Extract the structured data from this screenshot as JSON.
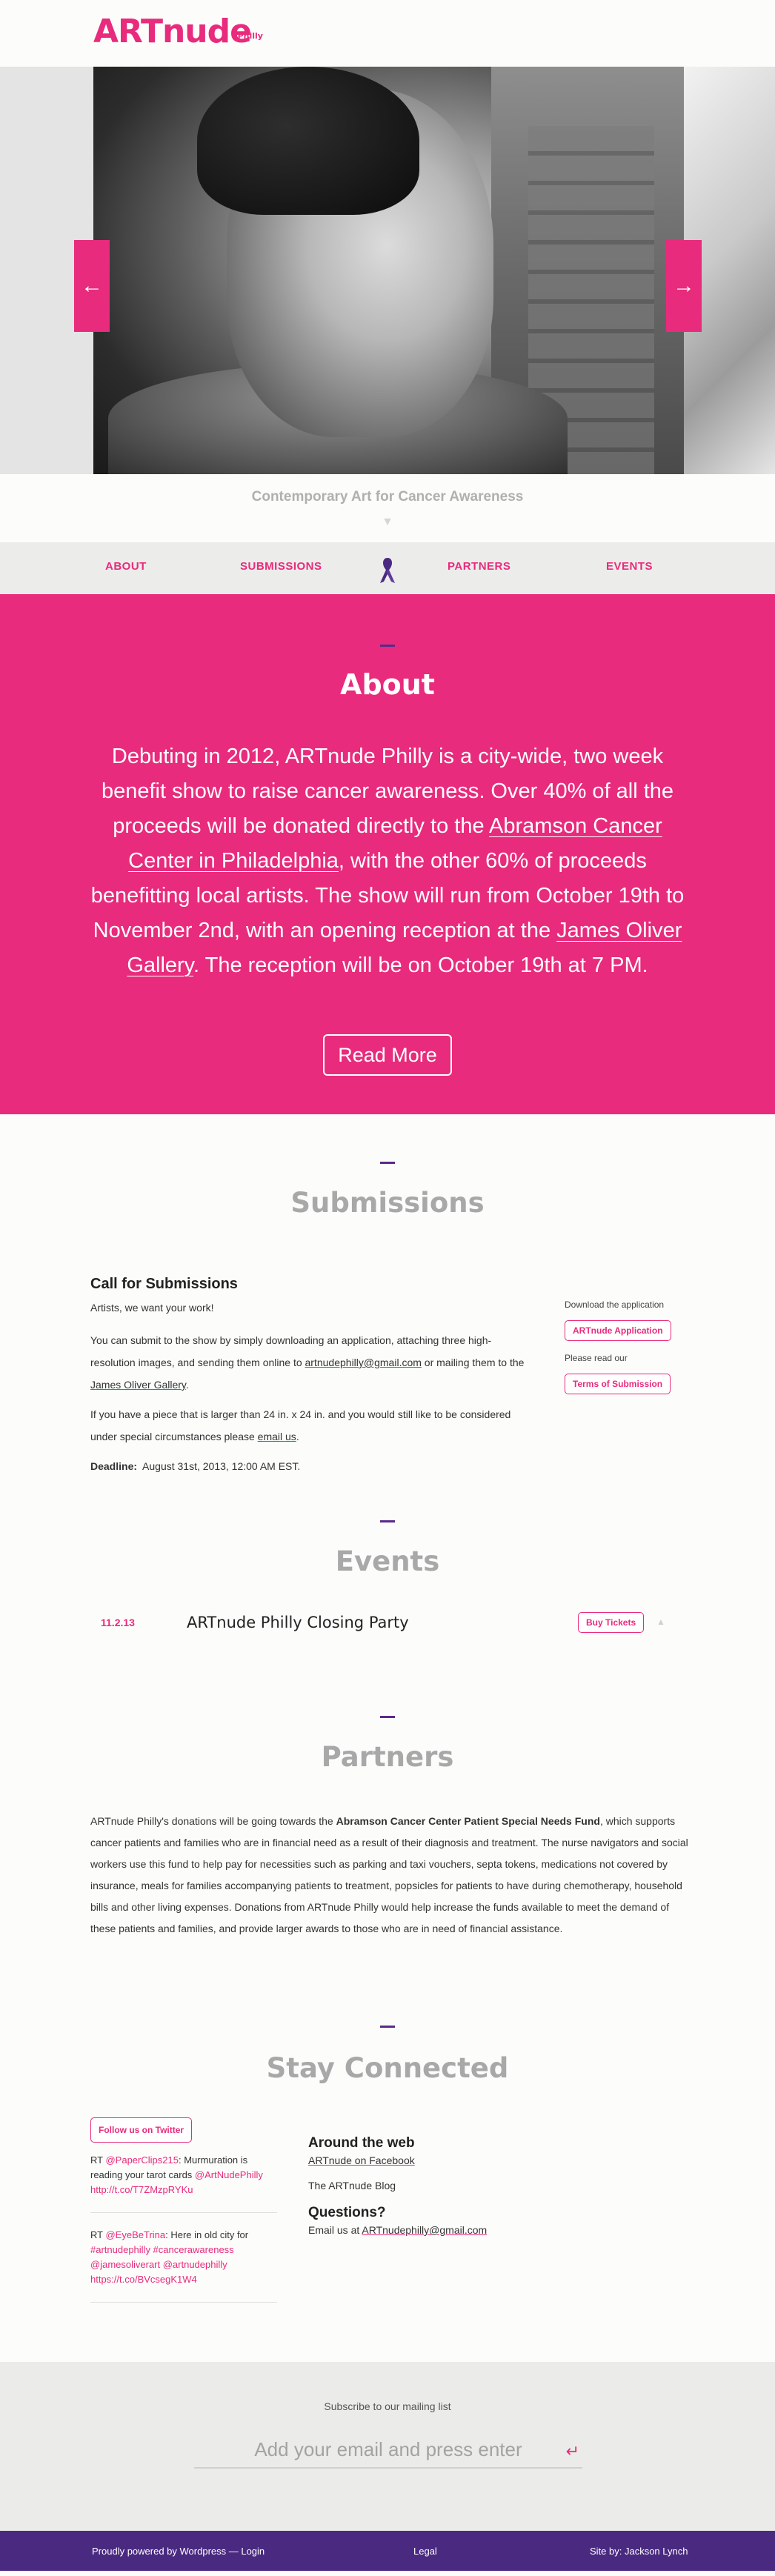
{
  "header": {
    "logo": "ARTnude",
    "logo_sup": "Philly"
  },
  "slider": {
    "prev": "←",
    "next": "→"
  },
  "tagline": {
    "text": "Contemporary Art for Cancer Awareness",
    "chevron": "▼"
  },
  "nav": {
    "about": "ABOUT",
    "submissions": "SUBMISSIONS",
    "partners": "PARTNERS",
    "events": "EVENTS"
  },
  "about": {
    "title": "About",
    "text_1": "Debuting in 2012, ARTnude Philly is a city-wide, two week benefit show to raise cancer awareness. Over 40% of all the proceeds will be donated directly to the ",
    "link_1": "Abramson Cancer Center in Philadelphia",
    "text_2": ", with the other 60% of proceeds benefitting local artists. The show will run from October 19th to November 2nd, with an opening reception at the ",
    "link_2": "James Oliver Gallery",
    "text_3": ". The reception will be on October 19th at 7 PM.",
    "button": "Read More"
  },
  "submissions": {
    "title": "Submissions",
    "heading": "Call for Submissions",
    "intro": "Artists, we want your work!",
    "p1_a": "You can submit to the show by simply downloading an application, attaching three high-resolution images, and sending them online to ",
    "p1_email": "artnudephilly@gmail.com",
    "p1_b": " or mailing them to the ",
    "p1_gallery": "James Oliver Gallery",
    "p1_c": ".",
    "p2_a": "If you have a piece that is larger than 24 in. x 24 in. and you would still like to be considered under special circumstances please ",
    "p2_link": "email us",
    "p2_b": ".",
    "deadline_label": "Deadline:",
    "deadline_value": "August 31st, 2013, 12:00 AM EST.",
    "download_label": "Download the application",
    "application_button": "ARTnude Application",
    "read_label": "Please read our",
    "terms_button": "Terms of Submission"
  },
  "events": {
    "title": "Events",
    "items": [
      {
        "date": "11.2.13",
        "name": "ARTnude Philly Closing Party",
        "button": "Buy Tickets",
        "caret": "▲"
      }
    ]
  },
  "partners": {
    "title": "Partners",
    "text_a": "ARTnude Philly's donations will be going towards the ",
    "text_bold": "Abramson Cancer Center Patient Special Needs Fund",
    "text_b": ", which supports cancer patients and families who are in financial need as a result of their diagnosis and treatment. The nurse navigators and social workers use this fund to help pay for necessities such as parking and taxi vouchers, septa tokens, medications not covered by insurance, meals for families accompanying patients to treatment, popsicles for patients to have during chemotherapy, household bills and other living expenses. Donations from ARTnude Philly would help increase the funds available to meet the demand of these patients and families, and provide larger awards to those who are in need of financial assistance."
  },
  "stay": {
    "title": "Stay Connected",
    "twitter_button": "Follow us on Twitter",
    "tweets": [
      {
        "a": "RT ",
        "m1": "@PaperClips215",
        "b": ": Murmuration is reading your tarot cards ",
        "m2": "@ArtNudePhilly",
        "c": " ",
        "m3": "http://t.co/T7ZMzpRYKu"
      },
      {
        "a": "RT ",
        "m1": "@EyeBeTrina",
        "b": ": Here in old city for ",
        "m2": "#artnudephilly #cancerawareness @jamesoliverart @artnudephilly",
        "c": " ",
        "m3": "https://t.co/BVcsegK1W4"
      }
    ],
    "around_title": "Around the web",
    "facebook": "ARTnude on Facebook",
    "blog": "The ARTnude Blog",
    "questions_title": "Questions?",
    "email_label": "Email us at ",
    "email": "ARTnudephilly@gmail.com"
  },
  "mailing": {
    "label": "Subscribe to our mailing list",
    "placeholder": "Add your email and press enter",
    "enter_icon": "↵"
  },
  "footer": {
    "left": "Proudly powered by Wordpress — Login",
    "center": "Legal",
    "right": "Site by: Jackson Lynch"
  },
  "colors": {
    "accent": "#e82b7c",
    "purple": "#4a2a80",
    "muted": "#a8a8a8"
  }
}
